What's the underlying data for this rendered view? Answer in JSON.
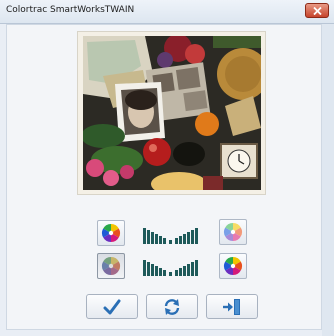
{
  "window": {
    "title": "Colortrac SmartWorksTWAIN",
    "close_icon": "close-icon"
  },
  "preview": {
    "icon": "scanned-photo-collage"
  },
  "color_tools": {
    "row1": [
      "color-wheel-icon",
      "tone-curve-icon",
      "color-wheel-light-icon"
    ],
    "row2": [
      "color-wheel-dim-icon",
      "tone-curve-icon",
      "color-wheel-icon"
    ]
  },
  "actions": {
    "accept_icon": "checkmark-icon",
    "refresh_icon": "refresh-icon",
    "exit_icon": "exit-door-icon"
  },
  "colors": {
    "accent_blue": "#2a6fb5",
    "curve_teal": "#1e5a5a"
  }
}
